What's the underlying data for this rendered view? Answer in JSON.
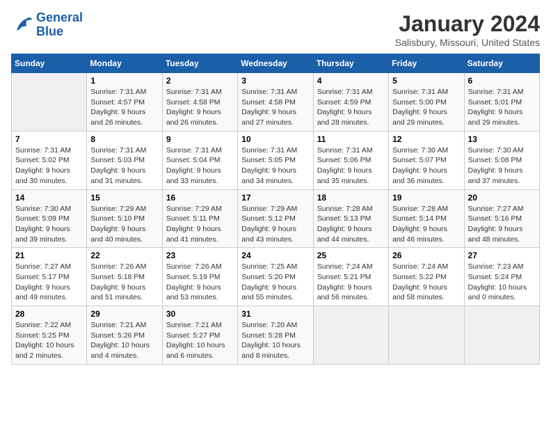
{
  "logo": {
    "line1": "General",
    "line2": "Blue"
  },
  "title": "January 2024",
  "subtitle": "Salisbury, Missouri, United States",
  "days_of_week": [
    "Sunday",
    "Monday",
    "Tuesday",
    "Wednesday",
    "Thursday",
    "Friday",
    "Saturday"
  ],
  "weeks": [
    [
      {
        "day": "",
        "info": ""
      },
      {
        "day": "1",
        "info": "Sunrise: 7:31 AM\nSunset: 4:57 PM\nDaylight: 9 hours\nand 26 minutes."
      },
      {
        "day": "2",
        "info": "Sunrise: 7:31 AM\nSunset: 4:58 PM\nDaylight: 9 hours\nand 26 minutes."
      },
      {
        "day": "3",
        "info": "Sunrise: 7:31 AM\nSunset: 4:58 PM\nDaylight: 9 hours\nand 27 minutes."
      },
      {
        "day": "4",
        "info": "Sunrise: 7:31 AM\nSunset: 4:59 PM\nDaylight: 9 hours\nand 28 minutes."
      },
      {
        "day": "5",
        "info": "Sunrise: 7:31 AM\nSunset: 5:00 PM\nDaylight: 9 hours\nand 29 minutes."
      },
      {
        "day": "6",
        "info": "Sunrise: 7:31 AM\nSunset: 5:01 PM\nDaylight: 9 hours\nand 29 minutes."
      }
    ],
    [
      {
        "day": "7",
        "info": "Sunrise: 7:31 AM\nSunset: 5:02 PM\nDaylight: 9 hours\nand 30 minutes."
      },
      {
        "day": "8",
        "info": "Sunrise: 7:31 AM\nSunset: 5:03 PM\nDaylight: 9 hours\nand 31 minutes."
      },
      {
        "day": "9",
        "info": "Sunrise: 7:31 AM\nSunset: 5:04 PM\nDaylight: 9 hours\nand 33 minutes."
      },
      {
        "day": "10",
        "info": "Sunrise: 7:31 AM\nSunset: 5:05 PM\nDaylight: 9 hours\nand 34 minutes."
      },
      {
        "day": "11",
        "info": "Sunrise: 7:31 AM\nSunset: 5:06 PM\nDaylight: 9 hours\nand 35 minutes."
      },
      {
        "day": "12",
        "info": "Sunrise: 7:30 AM\nSunset: 5:07 PM\nDaylight: 9 hours\nand 36 minutes."
      },
      {
        "day": "13",
        "info": "Sunrise: 7:30 AM\nSunset: 5:08 PM\nDaylight: 9 hours\nand 37 minutes."
      }
    ],
    [
      {
        "day": "14",
        "info": "Sunrise: 7:30 AM\nSunset: 5:09 PM\nDaylight: 9 hours\nand 39 minutes."
      },
      {
        "day": "15",
        "info": "Sunrise: 7:29 AM\nSunset: 5:10 PM\nDaylight: 9 hours\nand 40 minutes."
      },
      {
        "day": "16",
        "info": "Sunrise: 7:29 AM\nSunset: 5:11 PM\nDaylight: 9 hours\nand 41 minutes."
      },
      {
        "day": "17",
        "info": "Sunrise: 7:29 AM\nSunset: 5:12 PM\nDaylight: 9 hours\nand 43 minutes."
      },
      {
        "day": "18",
        "info": "Sunrise: 7:28 AM\nSunset: 5:13 PM\nDaylight: 9 hours\nand 44 minutes."
      },
      {
        "day": "19",
        "info": "Sunrise: 7:28 AM\nSunset: 5:14 PM\nDaylight: 9 hours\nand 46 minutes."
      },
      {
        "day": "20",
        "info": "Sunrise: 7:27 AM\nSunset: 5:16 PM\nDaylight: 9 hours\nand 48 minutes."
      }
    ],
    [
      {
        "day": "21",
        "info": "Sunrise: 7:27 AM\nSunset: 5:17 PM\nDaylight: 9 hours\nand 49 minutes."
      },
      {
        "day": "22",
        "info": "Sunrise: 7:26 AM\nSunset: 5:18 PM\nDaylight: 9 hours\nand 51 minutes."
      },
      {
        "day": "23",
        "info": "Sunrise: 7:26 AM\nSunset: 5:19 PM\nDaylight: 9 hours\nand 53 minutes."
      },
      {
        "day": "24",
        "info": "Sunrise: 7:25 AM\nSunset: 5:20 PM\nDaylight: 9 hours\nand 55 minutes."
      },
      {
        "day": "25",
        "info": "Sunrise: 7:24 AM\nSunset: 5:21 PM\nDaylight: 9 hours\nand 56 minutes."
      },
      {
        "day": "26",
        "info": "Sunrise: 7:24 AM\nSunset: 5:22 PM\nDaylight: 9 hours\nand 58 minutes."
      },
      {
        "day": "27",
        "info": "Sunrise: 7:23 AM\nSunset: 5:24 PM\nDaylight: 10 hours\nand 0 minutes."
      }
    ],
    [
      {
        "day": "28",
        "info": "Sunrise: 7:22 AM\nSunset: 5:25 PM\nDaylight: 10 hours\nand 2 minutes."
      },
      {
        "day": "29",
        "info": "Sunrise: 7:21 AM\nSunset: 5:26 PM\nDaylight: 10 hours\nand 4 minutes."
      },
      {
        "day": "30",
        "info": "Sunrise: 7:21 AM\nSunset: 5:27 PM\nDaylight: 10 hours\nand 6 minutes."
      },
      {
        "day": "31",
        "info": "Sunrise: 7:20 AM\nSunset: 5:28 PM\nDaylight: 10 hours\nand 8 minutes."
      },
      {
        "day": "",
        "info": ""
      },
      {
        "day": "",
        "info": ""
      },
      {
        "day": "",
        "info": ""
      }
    ]
  ]
}
